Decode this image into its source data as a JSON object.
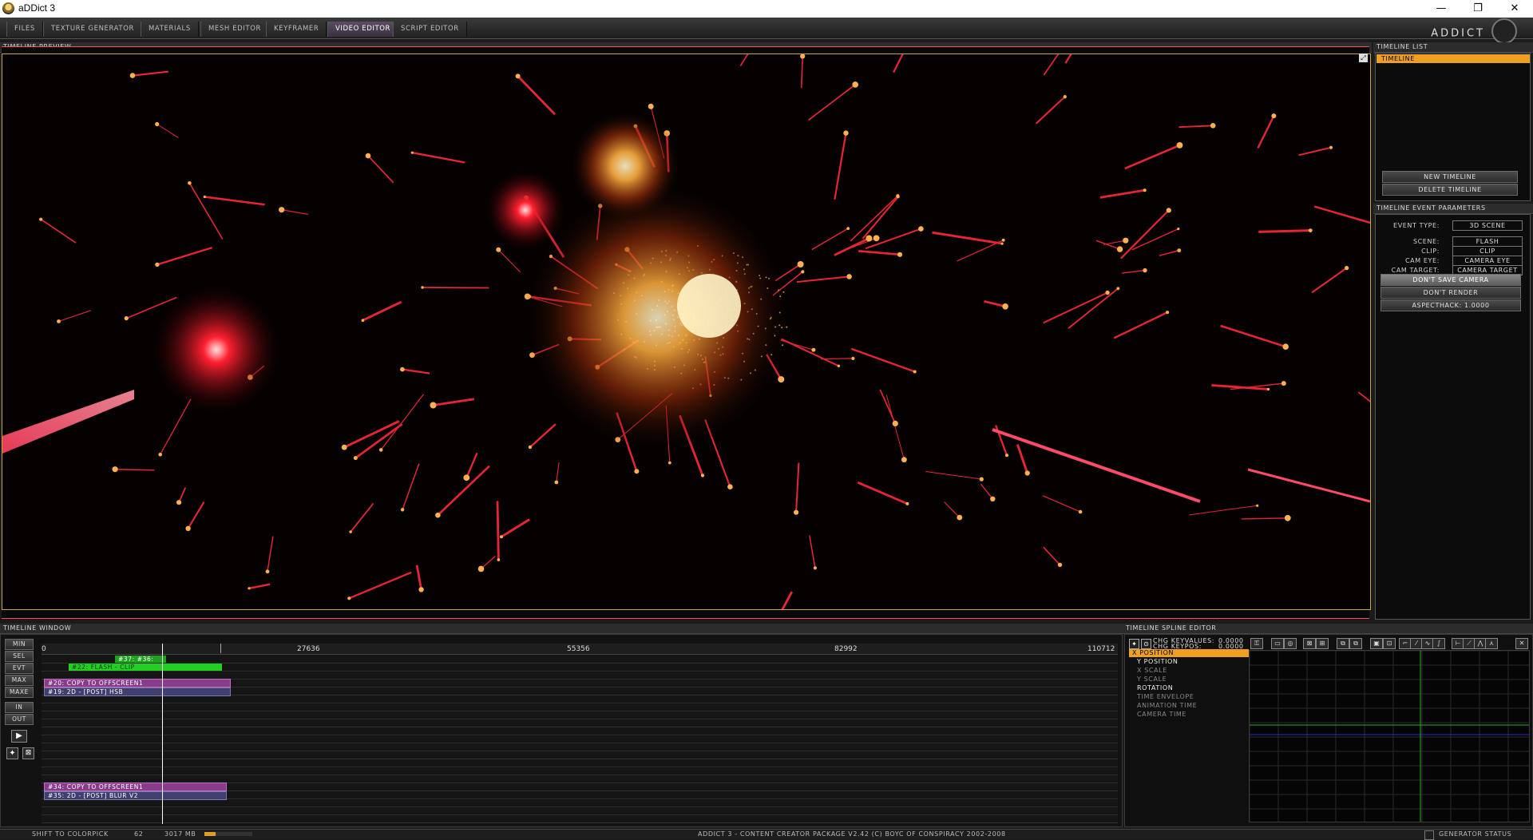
{
  "window": {
    "title": "aDDict 3",
    "minimize": "—",
    "restore": "❐",
    "close": "✕"
  },
  "tabs": [
    "FILES",
    "TEXTURE GENERATOR",
    "MATERIALS",
    "MESH EDITOR",
    "KEYFRAMER",
    "VIDEO EDITOR",
    "SCRIPT EDITOR"
  ],
  "active_tab": "VIDEO EDITOR",
  "brand": "ADDICT",
  "preview": {
    "header": "TIMELINE PREVIEW",
    "corner_icon": "maximize-icon"
  },
  "timeline_list": {
    "header": "TIMELINE LIST",
    "items": [
      "TIMELINE"
    ],
    "new_button": "NEW TIMELINE",
    "delete_button": "DELETE TIMELINE"
  },
  "event_params": {
    "header": "TIMELINE EVENT PARAMETERS",
    "event_type_label": "EVENT TYPE:",
    "event_type_value": "3D SCENE",
    "scene_label": "SCENE:",
    "scene_value": "FLASH",
    "clip_label": "CLIP:",
    "clip_value": "CLIP",
    "cam_eye_label": "CAM EYE:",
    "cam_eye_value": "CAMERA EYE",
    "cam_target_label": "CAM TARGET:",
    "cam_target_value": "CAMERA TARGET",
    "dont_save_camera": "DON'T SAVE CAMERA",
    "dont_render": "DON'T RENDER",
    "aspect_hack": "ASPECTHACK: 1.0000"
  },
  "timeline_window": {
    "header": "TIMELINE WINDOW",
    "side_buttons": [
      "MIN",
      "SEL",
      "EVT",
      "MAX",
      "MAXE",
      "IN",
      "OUT"
    ],
    "ruler": [
      "0",
      "27636",
      "55356",
      "82992",
      "110712"
    ],
    "events": [
      {
        "label": "#37: #36:",
        "color": "#1fa31f"
      },
      {
        "label": "#22: FLASH - CLIP",
        "color": "#22c922"
      },
      {
        "label": "#20: COPY TO OFFSCREEN1",
        "color": "#8a3c8c"
      },
      {
        "label": "#19: 2D - [POST] HSB",
        "color": "#4a4a7a"
      },
      {
        "label": "#34: COPY TO OFFSCREEN1",
        "color": "#8a3c8c"
      },
      {
        "label": "#35: 2D - [POST] BLUR V2",
        "color": "#4a4a7a"
      }
    ]
  },
  "spline_editor": {
    "header": "TIMELINE SPLINE EDITOR",
    "chg_keyvalues_label": "CHG KEYVALUES:",
    "chg_keyvalues_value": "0.0000",
    "chg_keypos_label": "CHG KEYPOS:",
    "chg_keypos_value": "0.0000",
    "channels": [
      "X POSITION",
      "Y POSITION",
      "X SCALE",
      "Y SCALE",
      "ROTATION",
      "TIME ENVELOPE",
      "ANIMATION TIME",
      "CAMERA TIME"
    ],
    "selected_channel": "X POSITION"
  },
  "status": {
    "hint": "SHIFT TO COLORPICK",
    "fps": "62",
    "memory": "3017 MB",
    "credits": "ADDICT 3 - CONTENT CREATOR PACKAGE V2.42 (C) BOYC OF CONSPIRACY 2002-2008",
    "generator_status": "GENERATOR STATUS"
  }
}
